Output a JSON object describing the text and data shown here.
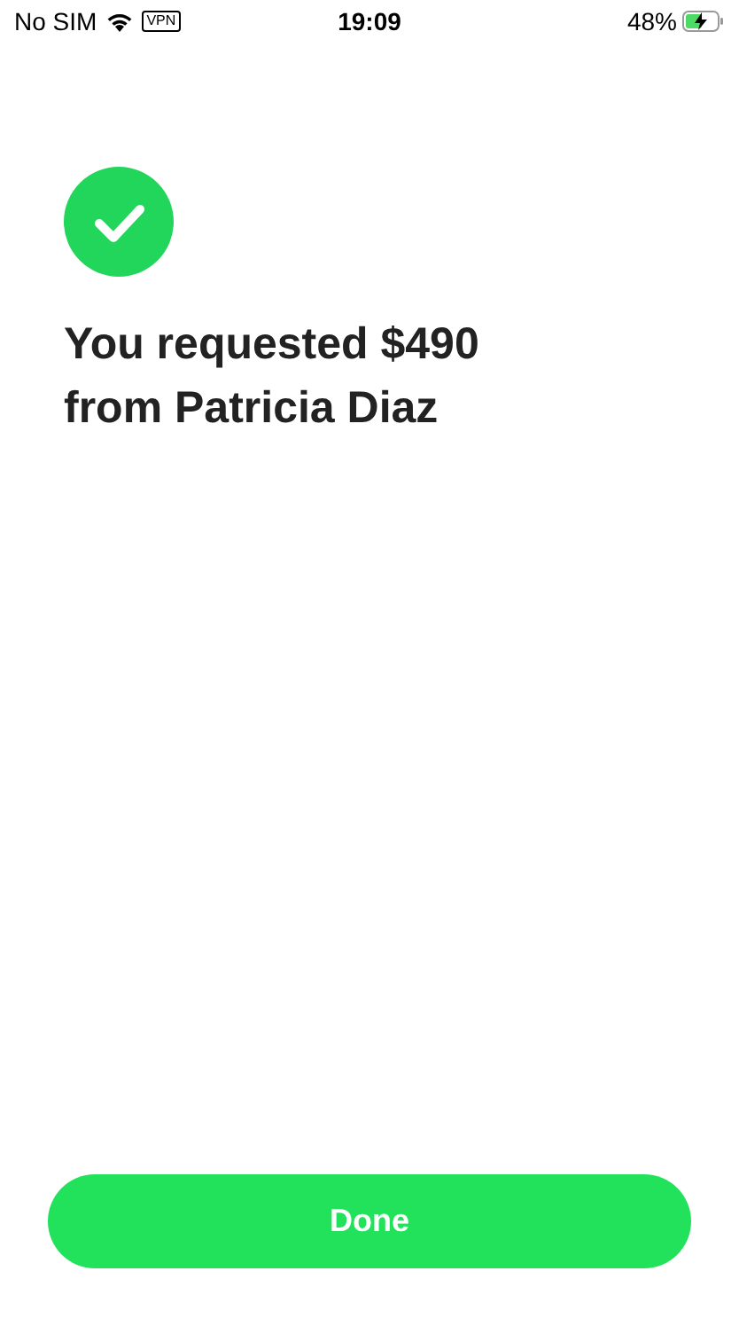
{
  "status_bar": {
    "carrier": "No SIM",
    "vpn": "VPN",
    "time": "19:09",
    "battery": "48%"
  },
  "confirmation": {
    "title": "You requested $490 from Patricia Diaz"
  },
  "button": {
    "label": "Done"
  }
}
